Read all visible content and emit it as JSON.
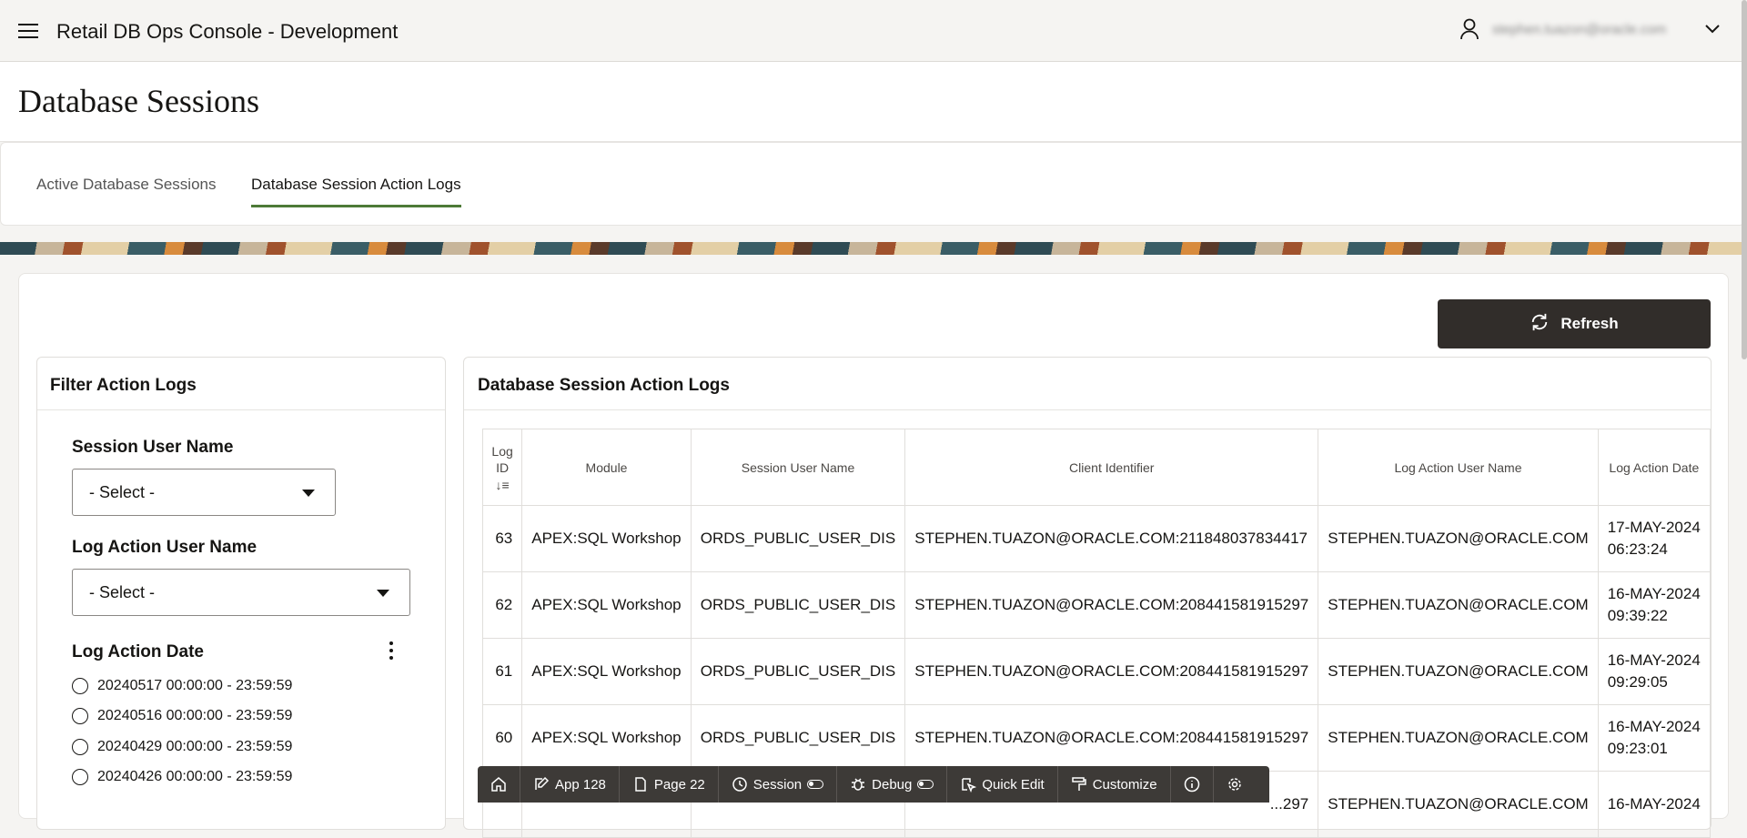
{
  "header": {
    "app_title": "Retail DB Ops Console - Development",
    "user_name": "stephen.tuazon@oracle.com"
  },
  "page": {
    "title": "Database Sessions"
  },
  "tabs": [
    {
      "label": "Active Database Sessions",
      "active": false
    },
    {
      "label": "Database Session Action Logs",
      "active": true
    }
  ],
  "actions": {
    "refresh_label": "Refresh"
  },
  "filter": {
    "heading": "Filter Action Logs",
    "session_user_label": "Session User Name",
    "session_user_value": "- Select -",
    "log_action_user_label": "Log Action User Name",
    "log_action_user_value": "- Select -",
    "log_action_date_label": "Log Action Date",
    "date_options": [
      "20240517 00:00:00 - 23:59:59",
      "20240516 00:00:00 - 23:59:59",
      "20240429 00:00:00 - 23:59:59",
      "20240426 00:00:00 - 23:59:59"
    ]
  },
  "report": {
    "heading": "Database Session Action Logs",
    "columns": {
      "log_id": "Log ID",
      "module": "Module",
      "session_user": "Session User Name",
      "client_identifier": "Client Identifier",
      "log_action_user": "Log Action User Name",
      "log_action_date": "Log Action Date"
    },
    "rows": [
      {
        "log_id": "63",
        "module": "APEX:SQL Workshop",
        "session_user": "ORDS_PUBLIC_USER_DIS",
        "client_identifier": "STEPHEN.TUAZON@ORACLE.COM:211848037834417",
        "log_action_user": "STEPHEN.TUAZON@ORACLE.COM",
        "date": "17-MAY-2024",
        "time": "06:23:24"
      },
      {
        "log_id": "62",
        "module": "APEX:SQL Workshop",
        "session_user": "ORDS_PUBLIC_USER_DIS",
        "client_identifier": "STEPHEN.TUAZON@ORACLE.COM:208441581915297",
        "log_action_user": "STEPHEN.TUAZON@ORACLE.COM",
        "date": "16-MAY-2024",
        "time": "09:39:22"
      },
      {
        "log_id": "61",
        "module": "APEX:SQL Workshop",
        "session_user": "ORDS_PUBLIC_USER_DIS",
        "client_identifier": "STEPHEN.TUAZON@ORACLE.COM:208441581915297",
        "log_action_user": "STEPHEN.TUAZON@ORACLE.COM",
        "date": "16-MAY-2024",
        "time": "09:29:05"
      },
      {
        "log_id": "60",
        "module": "APEX:SQL Workshop",
        "session_user": "ORDS_PUBLIC_USER_DIS",
        "client_identifier": "STEPHEN.TUAZON@ORACLE.COM:208441581915297",
        "log_action_user": "STEPHEN.TUAZON@ORACLE.COM",
        "date": "16-MAY-2024",
        "time": "09:23:01"
      },
      {
        "log_id": "",
        "module": "",
        "session_user": "",
        "client_identifier": "...297",
        "log_action_user": "STEPHEN.TUAZON@ORACLE.COM",
        "date": "16-MAY-2024",
        "time": ""
      }
    ]
  },
  "devbar": {
    "app": "App 128",
    "page": "Page 22",
    "session": "Session",
    "debug": "Debug",
    "quick_edit": "Quick Edit",
    "customize": "Customize"
  }
}
